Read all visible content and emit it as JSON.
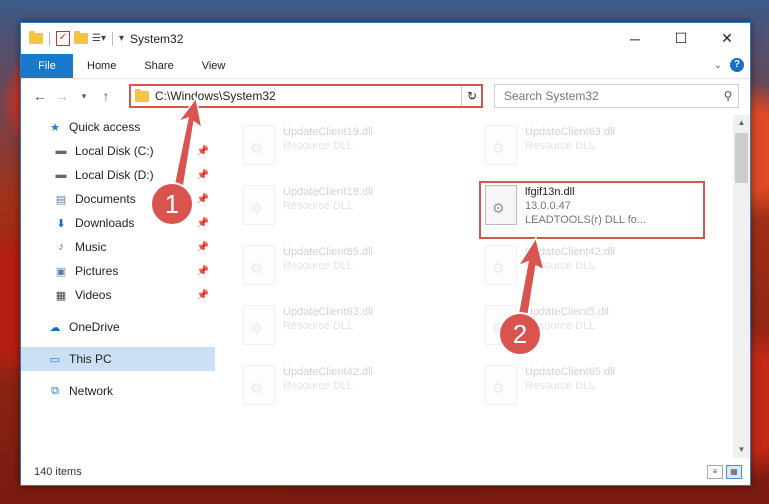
{
  "title": "System32",
  "ribbon": {
    "file": "File",
    "home": "Home",
    "share": "Share",
    "view": "View"
  },
  "address": {
    "path": "C:\\Windows\\System32"
  },
  "search": {
    "placeholder": "Search System32"
  },
  "sidebar": {
    "items": [
      {
        "label": "Quick access",
        "icon": "star-icon"
      },
      {
        "label": "Local Disk (C:)",
        "icon": "drive-icon"
      },
      {
        "label": "Local Disk (D:)",
        "icon": "drive-icon"
      },
      {
        "label": "Documents",
        "icon": "documents-icon"
      },
      {
        "label": "Downloads",
        "icon": "download-icon"
      },
      {
        "label": "Music",
        "icon": "music-icon"
      },
      {
        "label": "Pictures",
        "icon": "pictures-icon"
      },
      {
        "label": "Videos",
        "icon": "videos-icon"
      },
      {
        "label": "OneDrive",
        "icon": "cloud-icon"
      },
      {
        "label": "This PC",
        "icon": "pc-icon"
      },
      {
        "label": "Network",
        "icon": "network-icon"
      }
    ]
  },
  "files": [
    {
      "name": "UpdateClient19.dll",
      "sub1": "Resource DLL",
      "sub2": ""
    },
    {
      "name": "UpdateClient63.dll",
      "sub1": "Resource DLL",
      "sub2": ""
    },
    {
      "name": "UpdateClient19.dll",
      "sub1": "Resource DLL",
      "sub2": ""
    },
    {
      "name": "lfgif13n.dll",
      "sub1": "13.0.0.47",
      "sub2": "LEADTOOLS(r) DLL fo..."
    },
    {
      "name": "UpdateClient65.dll",
      "sub1": "Resource DLL",
      "sub2": ""
    },
    {
      "name": "UpdateClient42.dll",
      "sub1": "Resource DLL",
      "sub2": ""
    },
    {
      "name": "UpdateClient63.dll",
      "sub1": "Resource DLL",
      "sub2": ""
    },
    {
      "name": "UpdateClient5.dll",
      "sub1": "Resource DLL",
      "sub2": ""
    },
    {
      "name": "UpdateClient42.dll",
      "sub1": "Resource DLL",
      "sub2": ""
    },
    {
      "name": "UpdateClient65.dll",
      "sub1": "Resource DLL",
      "sub2": ""
    }
  ],
  "status": {
    "count": "140 items"
  },
  "markers": {
    "one": "1",
    "two": "2"
  },
  "colors": {
    "accent": "#1979ca",
    "highlight": "#d9534f"
  }
}
